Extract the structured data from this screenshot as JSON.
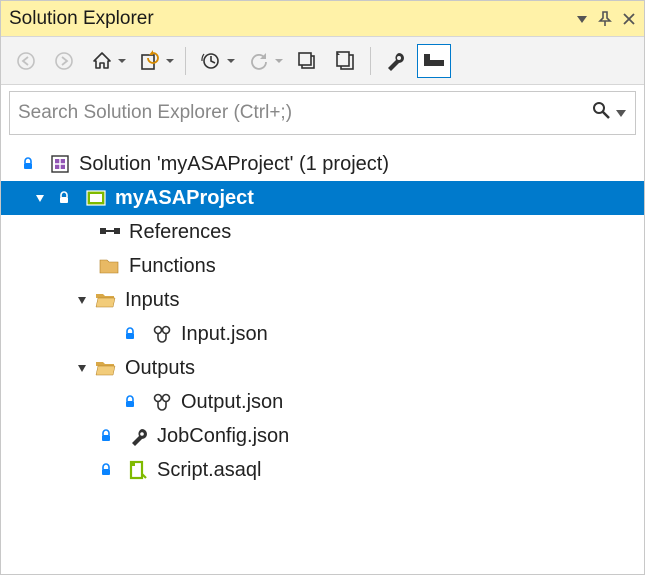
{
  "title": "Solution Explorer",
  "search": {
    "placeholder": "Search Solution Explorer (Ctrl+;)"
  },
  "tree": {
    "solution": "Solution 'myASAProject' (1 project)",
    "project": "myASAProject",
    "references": "References",
    "functions": "Functions",
    "inputs": "Inputs",
    "input_file": "Input.json",
    "outputs": "Outputs",
    "output_file": "Output.json",
    "jobconfig": "JobConfig.json",
    "script": "Script.asaql"
  }
}
